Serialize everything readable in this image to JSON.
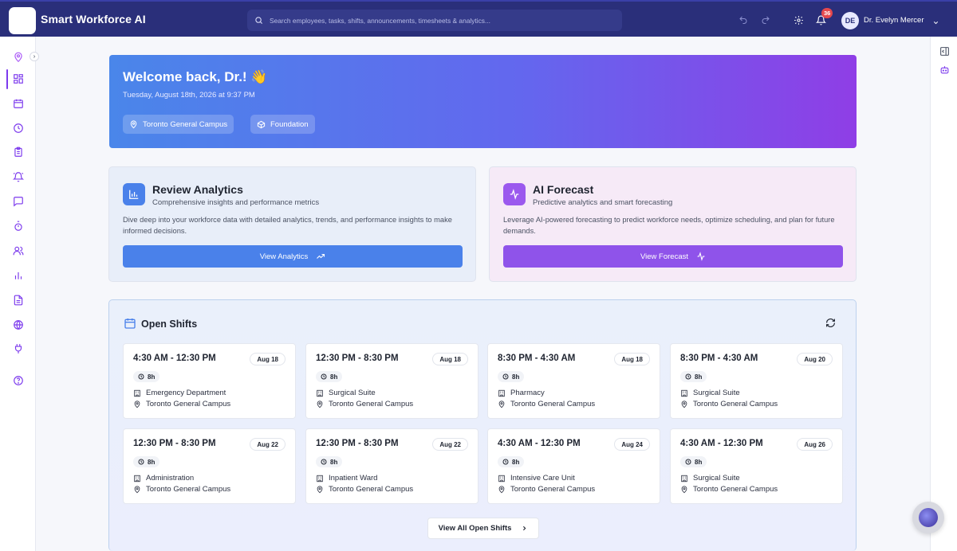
{
  "app": {
    "title": "Smart Workforce AI"
  },
  "search": {
    "placeholder": "Search employees, tasks, shifts, announcements, timesheets & analytics..."
  },
  "header": {
    "notification_count": "36",
    "user_initials": "DE",
    "user_name": "Dr. Evelyn Mercer"
  },
  "sidebar": {
    "items": [
      {
        "name": "location-pin-icon"
      },
      {
        "name": "dashboard-icon",
        "active": true
      },
      {
        "name": "calendar-icon"
      },
      {
        "name": "clock-icon"
      },
      {
        "name": "clipboard-icon"
      },
      {
        "name": "alarm-bell-icon"
      },
      {
        "name": "chat-icon"
      },
      {
        "name": "stopwatch-icon"
      },
      {
        "name": "users-icon"
      },
      {
        "name": "bar-chart-icon"
      },
      {
        "name": "document-icon"
      },
      {
        "name": "globe-icon"
      },
      {
        "name": "plug-icon"
      },
      {
        "name": "help-icon"
      }
    ]
  },
  "hero": {
    "title": "Welcome back, Dr.! 👋",
    "date": "Tuesday, August 18th, 2026 at 9:37 PM",
    "chips": [
      "Toronto General Campus",
      "Foundation"
    ]
  },
  "cards": {
    "analytics": {
      "title": "Review Analytics",
      "subtitle": "Comprehensive insights and performance metrics",
      "description": "Dive deep into your workforce data with detailed analytics, trends, and performance insights to make informed decisions.",
      "button": "View Analytics"
    },
    "forecast": {
      "title": "AI Forecast",
      "subtitle": "Predictive analytics and smart forecasting",
      "description": "Leverage AI-powered forecasting to predict workforce needs, optimize scheduling, and plan for future demands.",
      "button": "View Forecast"
    }
  },
  "open_shifts": {
    "title": "Open Shifts",
    "view_all": "View All Open Shifts",
    "shifts": [
      {
        "time": "4:30 AM - 12:30 PM",
        "date": "Aug 18",
        "duration": "8h",
        "department": "Emergency Department",
        "location": "Toronto General Campus"
      },
      {
        "time": "12:30 PM - 8:30 PM",
        "date": "Aug 18",
        "duration": "8h",
        "department": "Surgical Suite",
        "location": "Toronto General Campus"
      },
      {
        "time": "8:30 PM - 4:30 AM",
        "date": "Aug 18",
        "duration": "8h",
        "department": "Pharmacy",
        "location": "Toronto General Campus"
      },
      {
        "time": "8:30 PM - 4:30 AM",
        "date": "Aug 20",
        "duration": "8h",
        "department": "Surgical Suite",
        "location": "Toronto General Campus"
      },
      {
        "time": "12:30 PM - 8:30 PM",
        "date": "Aug 22",
        "duration": "8h",
        "department": "Administration",
        "location": "Toronto General Campus"
      },
      {
        "time": "12:30 PM - 8:30 PM",
        "date": "Aug 22",
        "duration": "8h",
        "department": "Inpatient Ward",
        "location": "Toronto General Campus"
      },
      {
        "time": "4:30 AM - 12:30 PM",
        "date": "Aug 24",
        "duration": "8h",
        "department": "Intensive Care Unit",
        "location": "Toronto General Campus"
      },
      {
        "time": "4:30 AM - 12:30 PM",
        "date": "Aug 26",
        "duration": "8h",
        "department": "Surgical Suite",
        "location": "Toronto General Campus"
      }
    ]
  },
  "colors": {
    "topbar": "#2a2f7a",
    "accent": "#7c3aed",
    "analytics_button": "#4a81ea",
    "forecast_button": "#8f53ea"
  }
}
